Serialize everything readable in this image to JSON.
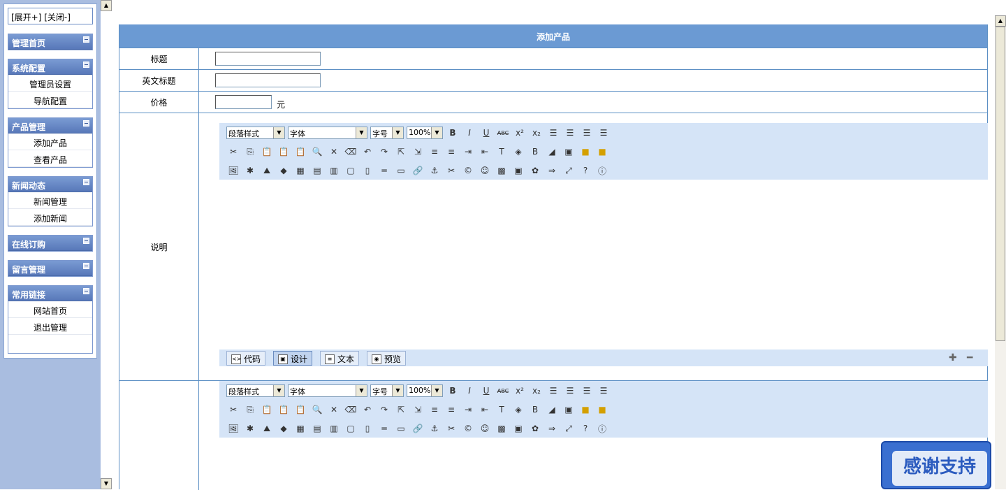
{
  "sidebar": {
    "expand": "[展开+]",
    "collapse": "[关闭-]",
    "groups": [
      {
        "title": "管理首页",
        "items": []
      },
      {
        "title": "系统配置",
        "items": [
          "管理员设置",
          "导航配置"
        ]
      },
      {
        "title": "产品管理",
        "items": [
          "添加产品",
          "查看产品"
        ]
      },
      {
        "title": "新闻动态",
        "items": [
          "新闻管理",
          "添加新闻"
        ]
      },
      {
        "title": "在线订购",
        "items": []
      },
      {
        "title": "留言管理",
        "items": []
      },
      {
        "title": "常用链接",
        "items": [
          "网站首页",
          "退出管理"
        ]
      }
    ]
  },
  "form": {
    "title": "添加产品",
    "title_label": "标题",
    "en_title_label": "英文标题",
    "price_label": "价格",
    "price_unit": "元",
    "desc_label": "说明"
  },
  "editor": {
    "paragraph": "段落样式",
    "font": "字体",
    "size": "字号",
    "zoom": "100%",
    "tabs": [
      "代码",
      "设计",
      "文本",
      "预览"
    ]
  },
  "badge": "感谢支持"
}
